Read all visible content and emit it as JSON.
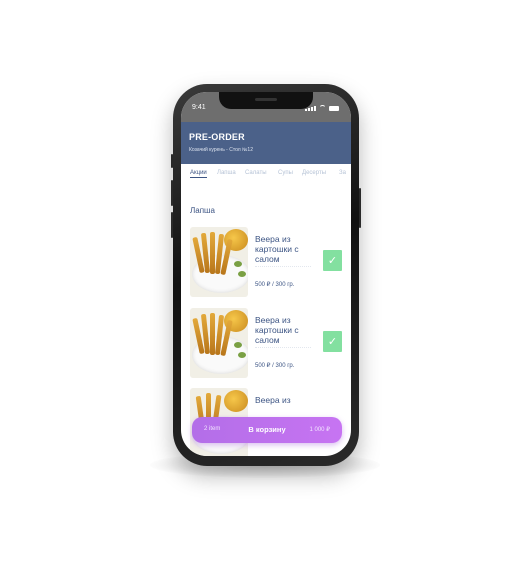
{
  "status": {
    "time": "9:41"
  },
  "header": {
    "title": "PRE-ORDER",
    "subtitle": "Козачий курень - Стол №12"
  },
  "tabs": [
    {
      "label": "Акции",
      "active": true
    },
    {
      "label": "Лапша",
      "active": false
    },
    {
      "label": "Салаты",
      "active": false
    },
    {
      "label": "Супы",
      "active": false
    },
    {
      "label": "Десерты",
      "active": false
    },
    {
      "label": "За",
      "active": false
    }
  ],
  "section": {
    "title": "Лапша"
  },
  "items": [
    {
      "name": "Веера из картошки с салом",
      "price": "500 ₽",
      "weight": "300 гр.",
      "selected": true
    },
    {
      "name": "Веера из картошки с салом",
      "price": "500 ₽",
      "weight": "300 гр.",
      "selected": true
    },
    {
      "name": "Веера из",
      "price": "",
      "weight": "",
      "selected": false
    }
  ],
  "cart": {
    "count": "2 item",
    "label": "В корзину",
    "total": "1 000 ₽"
  },
  "colors": {
    "header": "#4b6189",
    "accent": "#3d5584",
    "check": "#83e0a0",
    "cart": "#c070f0"
  },
  "icons": {
    "check": "check-icon",
    "signal": "signal-icon",
    "wifi": "wifi-icon",
    "battery": "battery-icon"
  }
}
